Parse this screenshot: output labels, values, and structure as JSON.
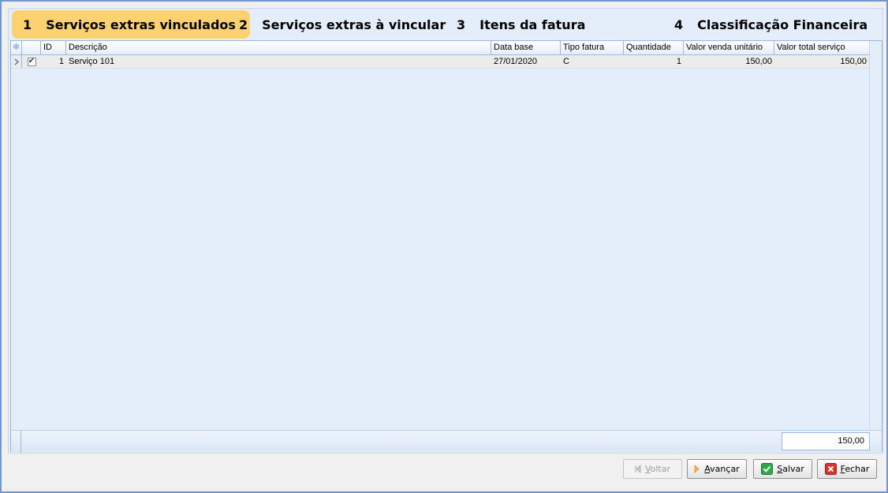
{
  "steps": [
    {
      "num": "1",
      "label": "Serviços extras vinculados",
      "active": true
    },
    {
      "num": "2",
      "label": "Serviços extras à vincular",
      "active": false
    },
    {
      "num": "3",
      "label": "Itens da fatura",
      "active": false
    },
    {
      "num": "4",
      "label": "Classificação Financeira",
      "active": false
    }
  ],
  "grid": {
    "columns": [
      "ID",
      "Descrição",
      "Data base",
      "Tipo fatura",
      "Quantidade",
      "Valor venda unitário",
      "Valor total serviço"
    ],
    "rows": [
      {
        "checked": true,
        "id": "1",
        "descricao": "Serviço 101",
        "data_base": "27/01/2020",
        "tipo_fatura": "C",
        "quantidade": "1",
        "valor_unitario": "150,00",
        "valor_total": "150,00"
      }
    ],
    "footer_total": "150,00"
  },
  "buttons": {
    "voltar": "Voltar",
    "avancar": "Avançar",
    "salvar": "Salvar",
    "fechar": "Fechar"
  },
  "icons": {
    "header_indicator": "asterisk-icon",
    "row_indicator": "row-pointer-icon",
    "voltar": "arrow-left-icon",
    "avancar": "arrow-right-icon",
    "salvar": "check-icon",
    "fechar": "close-icon"
  },
  "colors": {
    "active_step": "#fcd16f",
    "panel": "#e4eefb",
    "salvar_icon": "#2ea84a",
    "fechar_icon": "#d9342b",
    "avancar_icon": "#e8892b"
  }
}
